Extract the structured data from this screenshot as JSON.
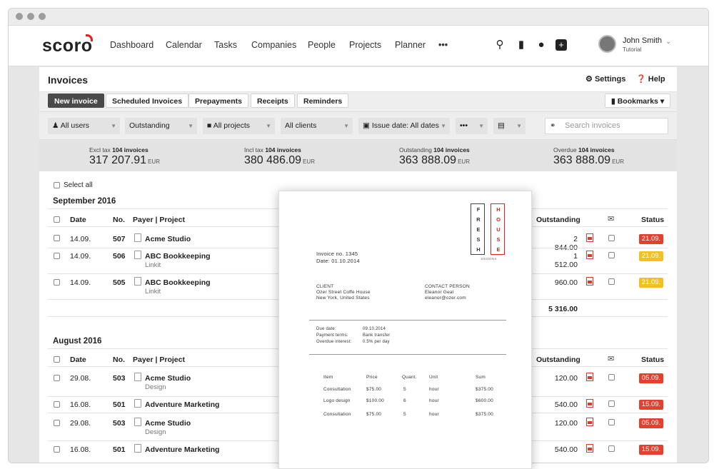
{
  "app": {
    "logo": "scoro"
  },
  "nav": {
    "items": [
      "Dashboard",
      "Calendar",
      "Tasks",
      "Companies",
      "People",
      "Projects",
      "Planner"
    ],
    "more": "•••"
  },
  "user": {
    "name": "John Smith",
    "role": "Tutorial"
  },
  "header": {
    "title": "Invoices",
    "settings": "Settings",
    "help": "Help"
  },
  "tabs": [
    "New invoice",
    "Scheduled Invoices",
    "Prepayments",
    "Receipts",
    "Reminders"
  ],
  "bookmarks": "Bookmarks",
  "filters": {
    "users": "All users",
    "status": "Outstanding",
    "projects": "All projects",
    "clients": "All clients",
    "date": "Issue date: All dates",
    "more": "•••",
    "search_placeholder": "Search invoices"
  },
  "totals": [
    {
      "label": "Excl tax",
      "count": "104 invoices",
      "value": "317 207.91",
      "cur": "EUR"
    },
    {
      "label": "Incl tax",
      "count": "104 invoices",
      "value": "380 486.09",
      "cur": "EUR"
    },
    {
      "label": "Outstanding",
      "count": "104 invoices",
      "value": "363 888.09",
      "cur": "EUR"
    },
    {
      "label": "Overdue",
      "count": "104 invoices",
      "value": "363 888.09",
      "cur": "EUR"
    }
  ],
  "select_all": "Select all",
  "columns": {
    "date": "Date",
    "no": "No.",
    "payer": "Payer | Project",
    "outstanding": "Outstanding",
    "status": "Status"
  },
  "groups": [
    {
      "month": "September 2016",
      "total": "5 316.00",
      "rows": [
        {
          "date": "14.09.",
          "no": "507",
          "payer": "Acme Studio",
          "project": "",
          "outstanding": "2 844.00",
          "status": "21.09.",
          "color": "#e3412f"
        },
        {
          "date": "14.09.",
          "no": "506",
          "payer": "ABC Bookkeeping",
          "project": "Linkit",
          "outstanding": "1 512.00",
          "status": "21.09.",
          "color": "#f2c11d"
        },
        {
          "date": "14.09.",
          "no": "505",
          "payer": "ABC Bookkeeping",
          "project": "Linkit",
          "outstanding": "960.00",
          "status": "21.09.",
          "color": "#f2c11d"
        }
      ]
    },
    {
      "month": "August 2016",
      "rows": [
        {
          "date": "29.08.",
          "no": "503",
          "payer": "Acme Studio",
          "project": "Design",
          "outstanding": "120.00",
          "status": "05.09.",
          "color": "#e3412f"
        },
        {
          "date": "16.08.",
          "no": "501",
          "payer": "Adventure Marketing",
          "project": "",
          "outstanding": "540.00",
          "status": "15.09.",
          "color": "#e3412f"
        },
        {
          "date": "29.08.",
          "no": "503",
          "payer": "Acme Studio",
          "project": "Design",
          "outstanding": "120.00",
          "status": "05.09.",
          "color": "#e3412f"
        },
        {
          "date": "16.08.",
          "no": "501",
          "payer": "Adventure Marketing",
          "project": "",
          "outstanding": "540.00",
          "status": "15.09.",
          "color": "#e3412f"
        }
      ]
    }
  ],
  "invoice_doc": {
    "logo_letters_left": [
      "F",
      "R",
      "E",
      "S",
      "H"
    ],
    "logo_letters_right": [
      "H",
      "O",
      "U",
      "S",
      "E"
    ],
    "logo_sub": "DESIGNS",
    "invoice_no": "Invoice no. 1345",
    "date": "Date:  01.10.2014",
    "client_label": "CLIENT",
    "client_name": "Ozer Street Coffe House",
    "client_city": "New York, United States",
    "contact_label": "CONTACT PERSON",
    "contact_name": "Eleanor Geal",
    "contact_email": "eleanor@ozer.com",
    "terms": [
      {
        "k": "Due date:",
        "v": "09.10.2014"
      },
      {
        "k": "Payment terms:",
        "v": "Bank transfer"
      },
      {
        "k": "Overdue interest:",
        "v": "0.5% per day"
      }
    ],
    "item_cols": [
      "Item",
      "Price",
      "Quant.",
      "Unit",
      "Sum"
    ],
    "items": [
      {
        "item": "Consultation",
        "price": "$75.00",
        "qty": "5",
        "unit": "hour",
        "sum": "$375.00"
      },
      {
        "item": "Logo design",
        "price": "$100.00",
        "qty": "6",
        "unit": "hour",
        "sum": "$600.00"
      },
      {
        "item": "Consultation",
        "price": "$75.00",
        "qty": "5",
        "unit": "hour",
        "sum": "$375.00"
      }
    ]
  }
}
